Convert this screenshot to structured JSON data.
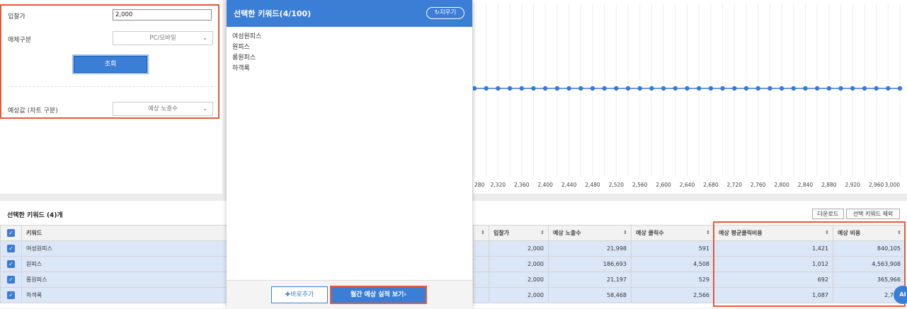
{
  "settings": {
    "bid_label": "입찰가",
    "bid_value": "2,000",
    "media_label": "매체구분",
    "media_value": "PC/모바일",
    "search_label": "조회",
    "estimate_label": "예상값 (차트 구분)",
    "estimate_value": "예상 노출수"
  },
  "modal": {
    "title": "선택한 키워드(4/100)",
    "clear_label": "지우기",
    "keywords": [
      "여성원피스",
      "원피스",
      "롱원피스",
      "하객룩"
    ],
    "quick_add_label": "바로추가",
    "monthly_label": "월간 예상 실적 보기"
  },
  "table_header": {
    "selected_count": "선택한 키워드 (4)개",
    "download_label": "다운로드",
    "exclude_label": "선택 키워드 제외"
  },
  "left_table": {
    "column": "키워드",
    "rows": [
      "여성원피스",
      "원피스",
      "롱원피스",
      "하객룩"
    ]
  },
  "right_table": {
    "columns": [
      "입찰가",
      "예상 노출수",
      "예상 클릭수",
      "예상 평균클릭비용",
      "예상 비용"
    ],
    "rows": [
      [
        "2,000",
        "21,998",
        "591",
        "1,421",
        "840,105"
      ],
      [
        "2,000",
        "186,693",
        "4,508",
        "1,012",
        "4,563,908"
      ],
      [
        "2,000",
        "21,197",
        "529",
        "692",
        "365,966"
      ],
      [
        "2,000",
        "58,468",
        "2,566",
        "1,087",
        "2,789"
      ]
    ]
  },
  "ai_badge": "AI",
  "chart_data": {
    "type": "line",
    "x_ticks": [
      "280",
      "2,320",
      "2,360",
      "2,400",
      "2,440",
      "2,480",
      "2,520",
      "2,560",
      "2,600",
      "2,640",
      "2,680",
      "2,720",
      "2,760",
      "2,800",
      "2,840",
      "2,880",
      "2,920",
      "2,960",
      "3,000"
    ],
    "points": 37,
    "line_color": "#3a78d4",
    "grid": true
  }
}
